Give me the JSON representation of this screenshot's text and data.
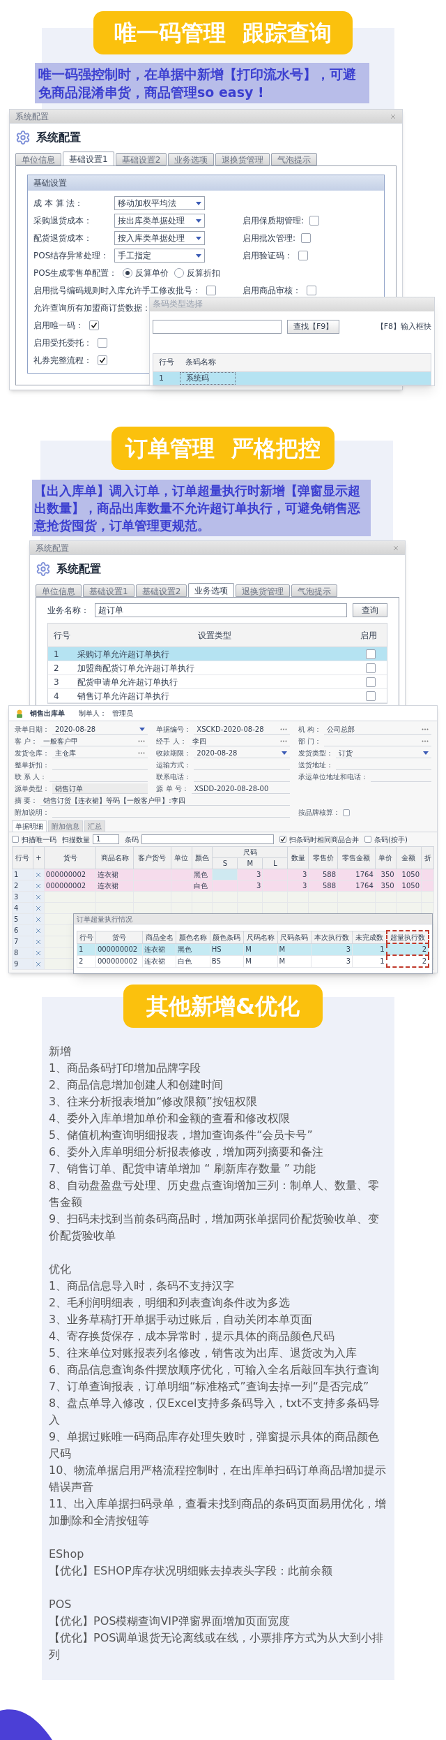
{
  "unique_code_section": {
    "banner": "唯一码管理 跟踪查询",
    "intro": "唯一码强控制时，在单据中新增【打印流水号】，可避免商品混淆串货，商品管理so easy !",
    "config_window": {
      "title": "系统配置",
      "heading": "系统配置",
      "tabs": [
        {
          "label": "单位信息",
          "selected": false
        },
        {
          "label": "基础设置1",
          "selected": true
        },
        {
          "label": "基础设置2",
          "selected": false
        },
        {
          "label": "业务选项",
          "selected": false
        },
        {
          "label": "退换货管理",
          "selected": false
        },
        {
          "label": "气泡提示",
          "selected": false
        }
      ],
      "group_title": "基础设置",
      "rows": [
        {
          "left": {
            "kind": "select",
            "label": "成 本 算 法：",
            "value": "移动加权平均法"
          }
        },
        {
          "left": {
            "kind": "select",
            "label": "采购退货成本：",
            "value": "按出库类单据处理"
          },
          "right": {
            "kind": "checkbox",
            "label": "启用保质期管理:",
            "checked": false
          }
        },
        {
          "left": {
            "kind": "select",
            "label": "配货退货成本：",
            "value": "按入库类单据处理"
          },
          "right": {
            "kind": "checkbox",
            "label": "启用批次管理:",
            "checked": false
          }
        },
        {
          "left": {
            "kind": "select",
            "label": "POS结存异常处理：",
            "value": "手工指定"
          },
          "right": {
            "kind": "checkbox",
            "label": "启用验证码：",
            "checked": false
          }
        },
        {
          "left": {
            "kind": "radio",
            "label": "POS生成零售单配置：",
            "options": [
              {
                "label": "反算单价",
                "selected": true
              },
              {
                "label": "反算折扣",
                "selected": false
              }
            ]
          }
        },
        {
          "left": {
            "kind": "checkbox",
            "label": "启用批号编码规则时入库允许手工修改批号：",
            "checked": false
          },
          "right": {
            "kind": "checkbox",
            "label": "启用商品审核：",
            "checked": false
          }
        },
        {
          "left": {
            "kind": "label",
            "label": "允许查询所有加盟商订货数据："
          }
        },
        {
          "left": {
            "kind": "checkbox",
            "label": "启用唯一码：",
            "checked": true
          }
        },
        {
          "left": {
            "kind": "checkbox",
            "label": "启用受托委托：",
            "checked": false
          }
        },
        {
          "left": {
            "kind": "checkbox",
            "label": "礼券完整流程：",
            "checked": true
          }
        }
      ]
    },
    "barcode_dialog": {
      "title": "条码类型选择",
      "search_button": "查找【F9】",
      "hint": "【F8】输入框快",
      "columns": [
        "行号",
        "条码名称"
      ],
      "rows": [
        {
          "cells": [
            "1",
            "系统码"
          ],
          "selected": true
        }
      ]
    }
  },
  "order_section": {
    "banner": "订单管理 严格把控",
    "intro": "【出入库单】调入订单，订单超量执行时新增【弹窗显示超出数量】，商品出库数量不允许超订单执行，可避免销售恶意抢货囤货，订单管理更规范。",
    "config_window": {
      "title": "系统配置",
      "heading": "系统配置",
      "tabs": [
        {
          "label": "单位信息",
          "selected": false
        },
        {
          "label": "基础设置1",
          "selected": false
        },
        {
          "label": "基础设置2",
          "selected": false
        },
        {
          "label": "业务选项",
          "selected": true
        },
        {
          "label": "退换货管理",
          "selected": false
        },
        {
          "label": "气泡提示",
          "selected": false
        }
      ],
      "query_label": "业务名称：",
      "query_value": "超订单",
      "query_button": "查询",
      "columns": [
        "行号",
        "设置类型",
        "启用"
      ],
      "rows": [
        {
          "no": "1",
          "name": "采购订单允许超订单执行",
          "checked": false,
          "selected": true
        },
        {
          "no": "2",
          "name": "加盟商配货订单允许超订单执行",
          "checked": false,
          "selected": false
        },
        {
          "no": "3",
          "name": "配货申请单允许超订单执行",
          "checked": false,
          "selected": false
        },
        {
          "no": "4",
          "name": "销售订单允许超订单执行",
          "checked": false,
          "selected": false
        }
      ]
    }
  },
  "sales_window": {
    "title": "销售出库单",
    "maker_label": "制单人：",
    "maker": "管理员",
    "fields": [
      {
        "kind": "date",
        "label": "录单日期：",
        "value": "2020-08-28"
      },
      {
        "kind": "lookup",
        "label": "单据编号：",
        "value": "XSCKD-2020-08-28"
      },
      {
        "kind": "lookup",
        "label": "机 构：",
        "value": "公司总部"
      },
      {
        "kind": "lookup",
        "label": "客 户：",
        "value": "一般客户甲"
      },
      {
        "kind": "lookup",
        "label": "经手 人：",
        "value": "李四"
      },
      {
        "kind": "lookup",
        "label": "部 门："
      },
      {
        "kind": "lookup",
        "label": "发货仓库：",
        "value": "主仓库"
      },
      {
        "kind": "date",
        "label": "收款期限：",
        "value": "2020-08-28"
      },
      {
        "kind": "date",
        "label": "发货类型：",
        "value": "订货"
      },
      {
        "kind": "text",
        "label": "整单折扣："
      },
      {
        "kind": "text",
        "label": "运输方式："
      },
      {
        "kind": "text",
        "label": "送货地址："
      },
      {
        "kind": "text",
        "label": "联 系 人："
      },
      {
        "kind": "text",
        "label": "联系电话："
      },
      {
        "kind": "text",
        "label": "承运单位地址和电话："
      },
      {
        "kind": "readonly",
        "label": "源单类型：",
        "value": "销售订单"
      },
      {
        "kind": "text",
        "label": "源 单 号：",
        "value": "XSDD-2020-08-28-00"
      },
      {
        "kind": "memo",
        "label": "摘 要：",
        "value": "销售订货【连衣裙】等码【一般客户甲】:李四"
      },
      {
        "kind": "memo",
        "label": "附加说明："
      },
      {
        "kind": "checkbox",
        "label": "按品牌核算：",
        "checked": false
      }
    ],
    "tabs": [
      {
        "label": "单据明细",
        "selected": true
      },
      {
        "label": "附加信息",
        "selected": false
      },
      {
        "label": "汇总",
        "selected": false
      }
    ],
    "toolbar": [
      {
        "kind": "checkbox",
        "label": "扫描唯一码",
        "checked": false
      },
      {
        "kind": "number",
        "label": "扫描数量",
        "value": "1"
      },
      {
        "kind": "input",
        "label": "条码"
      },
      {
        "kind": "checkbox",
        "label": "扫条码时相同商品合并",
        "checked": true
      },
      {
        "kind": "checkbox",
        "label": "条码(按手)",
        "checked": false
      }
    ],
    "columns_before": [
      "行号",
      "+",
      "货号",
      "商品名称",
      "客户货号",
      "单位",
      "颜色"
    ],
    "size_group": {
      "label": "尺码",
      "columns": [
        "S",
        "M",
        "L"
      ]
    },
    "columns_after": [
      "数量",
      "零售价",
      "零售金额",
      "单价",
      "金额",
      "折"
    ],
    "rows": [
      {
        "no": "1",
        "code": "000000002",
        "name": "连衣裙",
        "color_name": "黑色",
        "size_m": "3",
        "qty": "3",
        "retail_price": "588",
        "retail_amount": "1764",
        "price": "350",
        "amount": "1050"
      },
      {
        "no": "2",
        "code": "000000002",
        "name": "连衣裙",
        "color_name": "白色",
        "size_m": "3",
        "qty": "3",
        "retail_price": "588",
        "retail_amount": "1764",
        "price": "350",
        "amount": "1050"
      },
      {
        "no": "3"
      },
      {
        "no": "4"
      },
      {
        "no": "5"
      },
      {
        "no": "6"
      },
      {
        "no": "7"
      },
      {
        "no": "8"
      },
      {
        "no": "9"
      }
    ],
    "popup": {
      "title": "订单超量执行情况",
      "columns": [
        "行号",
        "货号",
        "商品全名",
        "颜色名称",
        "颜色条码",
        "尺码名称",
        "尺码条码",
        "本次执行数",
        "未完成数",
        "超量执行数"
      ],
      "rows": [
        {
          "cells": [
            "1",
            "000000002",
            "连衣裙",
            "黑色",
            "HS",
            "M",
            "M",
            "3",
            "1",
            "2"
          ],
          "selected": true
        },
        {
          "cells": [
            "2",
            "000000002",
            "连衣裙",
            "白色",
            "BS",
            "M",
            "M",
            "3",
            "1",
            "2"
          ],
          "selected": false
        }
      ]
    }
  },
  "other_section": {
    "banner": "其他新增&优化",
    "groups": [
      {
        "title": "新增",
        "items": [
          "1、商品条码打印增加品牌字段",
          "2、商品信息增加创建人和创建时间",
          "3、往来分析报表增加“修改限额”按钮权限",
          "4、委外入库单增加单价和金额的查看和修改权限",
          "5、储值机构查询明细报表，增加查询条件“会员卡号”",
          "6、委外入库单明细分析报表修改，增加两列摘要和备注",
          "7、销售订单、配货申请单增加 “ 刷新库存数量 ” 功能",
          "8、自动盘盈盘亏处理、历史盘点查询增加三列：制单人、数量、零售金额",
          "9、扫码未找到当前条码商品时，增加两张单据同价配货验收单、变价配货验收单"
        ]
      },
      {
        "title": "优化",
        "items": [
          "1、商品信息导入时，条码不支持汉字",
          "2、毛利润明细表，明细和列表查询条件改为多选",
          "3、业务草稿打开单据手动过账后，自动关闭本单页面",
          "4、寄存换货保存，成本异常时，提示具体的商品颜色尺码",
          "5、往来单位对账报表列名修改，销售改为出库、退货改为入库",
          "6、商品信息查询条件摆放顺序优化，可输入全名后敲回车执行查询",
          "7、订单查询报表，订单明细“标准格式”查询去掉一列“是否完成”",
          "8、盘点单导入修改，仅Excel支持多条码导入，txt不支持多条码导入",
          "9、单据过账唯一码商品库存处理失败时，弹窗提示具体的商品颜色尺码",
          "10、物流单据启用严格流程控制时，在出库单扫码订单商品增加提示错误声音",
          "11、出入库单据扫码录单，查看未找到商品的条码页面易用优化，增加删除和全清按钮等"
        ]
      },
      {
        "title": "EShop",
        "items": [
          "【优化】ESHOP库存状况明细账去掉表头字段：此前余额"
        ]
      },
      {
        "title": "POS",
        "items": [
          "【优化】POS模糊查询VIP弹窗界面增加页面宽度",
          "【优化】POS调单退货无论离线或在线，小票排序方式为从大到小排列"
        ]
      }
    ]
  }
}
